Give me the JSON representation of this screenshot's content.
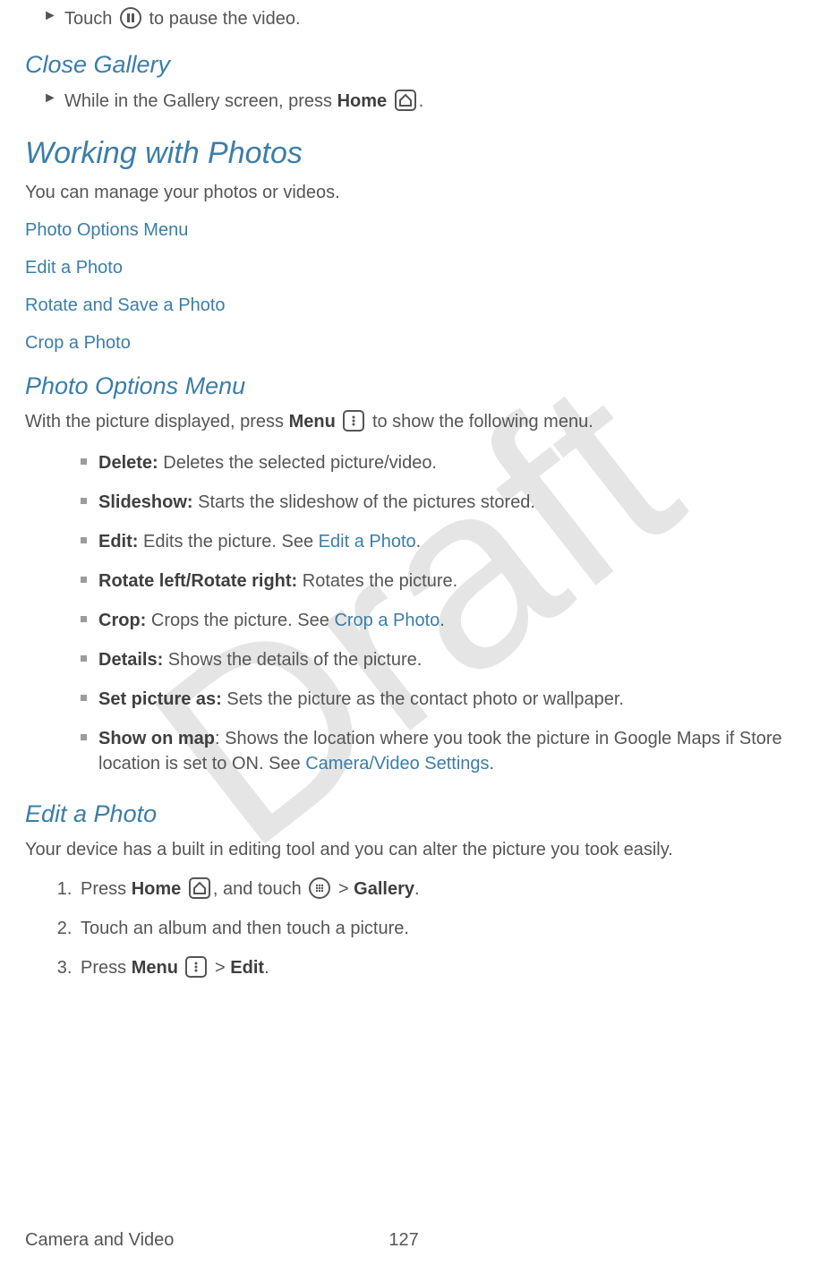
{
  "watermark": "Draft",
  "pauseLine": {
    "pre": "Touch ",
    "post": " to pause the video."
  },
  "closeGallery": {
    "heading": "Close Gallery",
    "line_pre": "While in the Gallery screen, press ",
    "line_bold": "Home",
    "line_post": "."
  },
  "working": {
    "heading": "Working with Photos",
    "intro": "You can manage your photos or videos."
  },
  "toc": {
    "i1": "Photo Options Menu",
    "i2": "Edit a Photo",
    "i3": "Rotate and Save a Photo",
    "i4": "Crop a Photo"
  },
  "photoOptions": {
    "heading": "Photo Options Menu",
    "intro_pre": "With the picture displayed, press ",
    "intro_bold": "Menu",
    "intro_post": " to show the following menu.",
    "items": [
      {
        "label": "Delete:",
        "text": " Deletes the selected picture/video."
      },
      {
        "label": "Slideshow:",
        "text": " Starts the slideshow of the pictures stored."
      },
      {
        "label": "Edit:",
        "text_pre": " Edits the picture. See ",
        "link": "Edit a Photo",
        "text_post": "."
      },
      {
        "label": "Rotate left/Rotate right:",
        "text": " Rotates the picture."
      },
      {
        "label": "Crop:",
        "text_pre": " Crops the picture. See ",
        "link": "Crop a Photo",
        "text_post": "."
      },
      {
        "label": "Details:",
        "text": " Shows the details of the picture."
      },
      {
        "label": "Set picture as:",
        "text": " Sets the picture as the contact photo or wallpaper."
      },
      {
        "label": "Show on map",
        "text_pre": ": Shows the location where you took the picture in Google Maps if Store location is set to ON. See ",
        "link": "Camera/Video Settings",
        "text_post": "."
      }
    ]
  },
  "editPhoto": {
    "heading": "Edit a Photo",
    "intro": "Your device has a built in editing tool and you can alter the picture you took easily.",
    "step1_pre": "Press ",
    "step1_b1": "Home",
    "step1_mid": ", and touch ",
    "step1_gt": " > ",
    "step1_b2": "Gallery",
    "step1_post": ".",
    "step2": "Touch an album and then touch a picture.",
    "step3_pre": "Press ",
    "step3_b1": "Menu",
    "step3_gt": " > ",
    "step3_b2": "Edit",
    "step3_post": "."
  },
  "footer": {
    "section": "Camera and Video",
    "page": "127"
  }
}
